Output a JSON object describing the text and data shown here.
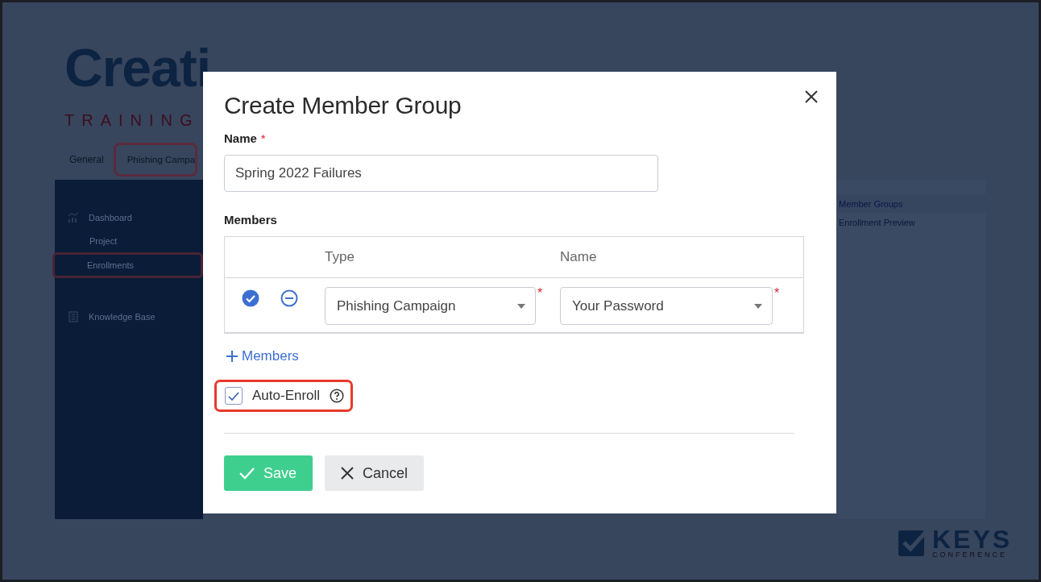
{
  "slide": {
    "title": "Creati",
    "subtitle": "TRAINING",
    "tabs": [
      {
        "label": "General",
        "selected": false
      },
      {
        "label": "Phishing Campa",
        "selected": true
      }
    ],
    "sidebar": {
      "items": [
        {
          "label": "Dashboard",
          "selected": false,
          "children": [
            {
              "label": "Project",
              "selected": false
            },
            {
              "label": "Enrollments",
              "selected": true
            }
          ]
        },
        {
          "label": "Knowledge Base",
          "selected": false
        }
      ]
    },
    "side_menu": {
      "items": [
        {
          "label": "Member Groups",
          "selected": true
        },
        {
          "label": "Enrollment Preview",
          "selected": false
        }
      ]
    },
    "logo": {
      "name": "KEYS",
      "tagline": "CONFERENCE"
    }
  },
  "dialog": {
    "title": "Create Member Group",
    "name_field": {
      "label": "Name",
      "required_mark": "*",
      "value": "Spring 2022 Failures"
    },
    "members": {
      "label": "Members",
      "columns": [
        "Type",
        "Name"
      ],
      "rows": [
        {
          "confirmed": true,
          "type": {
            "value": "Phishing Campaign",
            "required_mark": "*"
          },
          "name": {
            "value": "Your Password",
            "required_mark": "*"
          }
        }
      ],
      "add_link": "Members"
    },
    "auto_enroll": {
      "label": "Auto-Enroll",
      "checked": true,
      "highlighted": true
    },
    "buttons": [
      {
        "label": "Save",
        "kind": "primary"
      },
      {
        "label": "Cancel",
        "kind": "secondary"
      }
    ]
  }
}
